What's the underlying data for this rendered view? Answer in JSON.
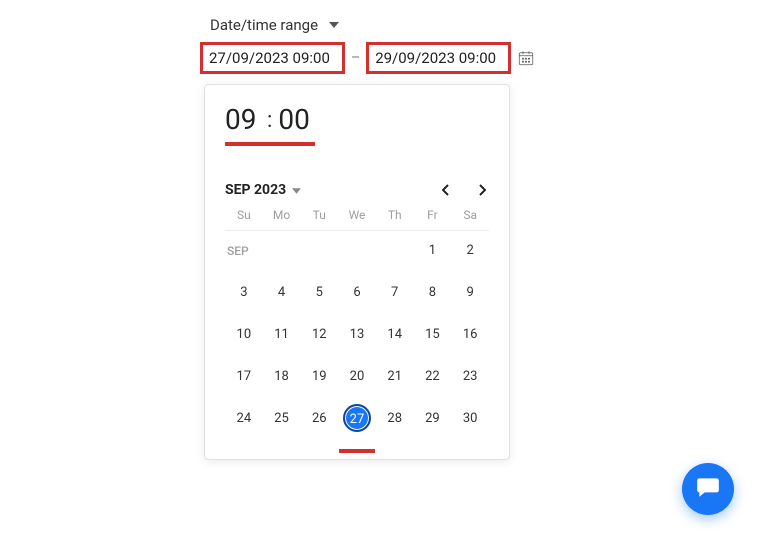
{
  "header": {
    "label": "Date/time range"
  },
  "range": {
    "start": "27/09/2023 09:00",
    "end": "29/09/2023 09:00",
    "separator": "–"
  },
  "time": {
    "hours": "09",
    "colon": ":",
    "minutes": "00"
  },
  "calendar": {
    "month_label": "SEP 2023",
    "month_short": "SEP",
    "weekdays": [
      "Su",
      "Mo",
      "Tu",
      "We",
      "Th",
      "Fr",
      "Sa"
    ],
    "grid": [
      {
        "label": "SEP",
        "type": "label"
      },
      {
        "label": "",
        "type": "blank"
      },
      {
        "label": "",
        "type": "blank"
      },
      {
        "label": "",
        "type": "blank"
      },
      {
        "label": "",
        "type": "blank"
      },
      {
        "label": "1",
        "type": "day"
      },
      {
        "label": "2",
        "type": "day"
      },
      {
        "label": "3",
        "type": "day"
      },
      {
        "label": "4",
        "type": "day"
      },
      {
        "label": "5",
        "type": "day"
      },
      {
        "label": "6",
        "type": "day"
      },
      {
        "label": "7",
        "type": "day"
      },
      {
        "label": "8",
        "type": "day"
      },
      {
        "label": "9",
        "type": "day"
      },
      {
        "label": "10",
        "type": "day"
      },
      {
        "label": "11",
        "type": "day"
      },
      {
        "label": "12",
        "type": "day"
      },
      {
        "label": "13",
        "type": "day"
      },
      {
        "label": "14",
        "type": "day"
      },
      {
        "label": "15",
        "type": "day"
      },
      {
        "label": "16",
        "type": "day"
      },
      {
        "label": "17",
        "type": "day"
      },
      {
        "label": "18",
        "type": "day"
      },
      {
        "label": "19",
        "type": "day"
      },
      {
        "label": "20",
        "type": "day"
      },
      {
        "label": "21",
        "type": "day"
      },
      {
        "label": "22",
        "type": "day"
      },
      {
        "label": "23",
        "type": "day"
      },
      {
        "label": "24",
        "type": "day"
      },
      {
        "label": "25",
        "type": "day"
      },
      {
        "label": "26",
        "type": "day"
      },
      {
        "label": "27",
        "type": "day",
        "selected": true
      },
      {
        "label": "28",
        "type": "day"
      },
      {
        "label": "29",
        "type": "day"
      },
      {
        "label": "30",
        "type": "day"
      }
    ]
  }
}
